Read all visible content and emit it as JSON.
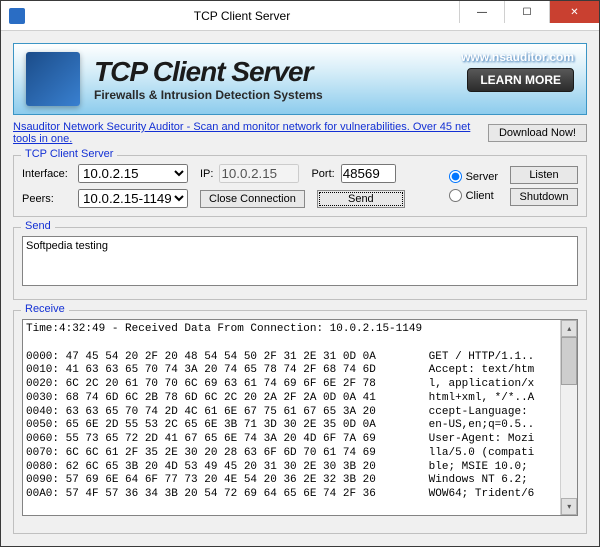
{
  "window": {
    "title": "TCP Client Server"
  },
  "banner": {
    "title": "TCP Client Server",
    "subtitle": "Firewalls & Intrusion Detection Systems",
    "url": "www.nsauditor.com",
    "learn_more": "LEARN MORE"
  },
  "promo": {
    "link": "Nsauditor Network Security Auditor - Scan and monitor network for vulnerabilities. Over 45 net tools in one.",
    "download": "Download Now!"
  },
  "tcp_group": {
    "label": "TCP Client Server",
    "interface_label": "Interface:",
    "interface_value": "10.0.2.15",
    "ip_label": "IP:",
    "ip_value": "10.0.2.15",
    "port_label": "Port:",
    "port_value": "48569",
    "peers_label": "Peers:",
    "peers_value": "10.0.2.15-1149",
    "close_conn": "Close Connection",
    "send_btn": "Send",
    "server_label": "Server",
    "client_label": "Client",
    "listen": "Listen",
    "shutdown": "Shutdown",
    "mode": "server"
  },
  "send": {
    "label": "Send",
    "content": "Softpedia testing"
  },
  "receive": {
    "label": "Receive",
    "content": "Time:4:32:49 - Received Data From Connection: 10.0.2.15-1149\n\n0000: 47 45 54 20 2F 20 48 54 54 50 2F 31 2E 31 0D 0A        GET / HTTP/1.1..\n0010: 41 63 63 65 70 74 3A 20 74 65 78 74 2F 68 74 6D        Accept: text/htm\n0020: 6C 2C 20 61 70 70 6C 69 63 61 74 69 6F 6E 2F 78        l, application/x\n0030: 68 74 6D 6C 2B 78 6D 6C 2C 20 2A 2F 2A 0D 0A 41        html+xml, */*..A\n0040: 63 63 65 70 74 2D 4C 61 6E 67 75 61 67 65 3A 20        ccept-Language: \n0050: 65 6E 2D 55 53 2C 65 6E 3B 71 3D 30 2E 35 0D 0A        en-US,en;q=0.5..\n0060: 55 73 65 72 2D 41 67 65 6E 74 3A 20 4D 6F 7A 69        User-Agent: Mozi\n0070: 6C 6C 61 2F 35 2E 30 20 28 63 6F 6D 70 61 74 69        lla/5.0 (compati\n0080: 62 6C 65 3B 20 4D 53 49 45 20 31 30 2E 30 3B 20        ble; MSIE 10.0; \n0090: 57 69 6E 64 6F 77 73 20 4E 54 20 36 2E 32 3B 20        Windows NT 6.2; \n00A0: 57 4F 57 36 34 3B 20 54 72 69 64 65 6E 74 2F 36        WOW64; Trident/6"
  }
}
